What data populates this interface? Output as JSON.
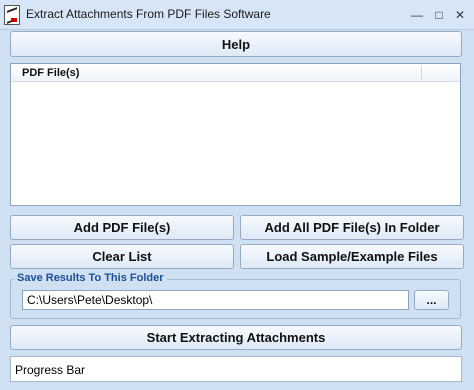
{
  "window": {
    "title": "Extract Attachments From PDF Files Software",
    "icon": "pdf-app-icon"
  },
  "buttons": {
    "help": "Help",
    "add_pdf": "Add PDF File(s)",
    "add_all_pdf": "Add All PDF File(s) In Folder",
    "clear_list": "Clear List",
    "load_sample": "Load Sample/Example Files",
    "browse": "...",
    "start": "Start Extracting Attachments"
  },
  "file_list": {
    "column_header": "PDF File(s)",
    "items": []
  },
  "output": {
    "group_label": "Save Results To This Folder",
    "folder_path": "C:\\Users\\Pete\\Desktop\\"
  },
  "progress": {
    "label": "Progress Bar",
    "value": 0
  },
  "colors": {
    "background": "#cfe0f3",
    "group_label": "#1d4f9a"
  }
}
